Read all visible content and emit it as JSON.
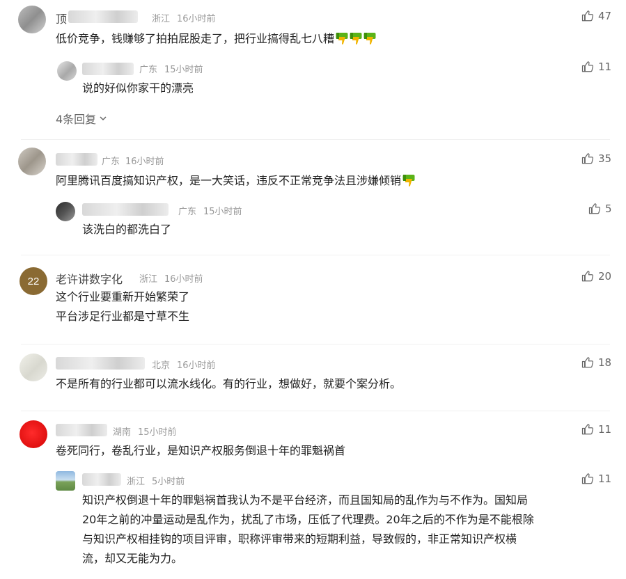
{
  "comments": [
    {
      "name": "顶",
      "location": "浙江",
      "time": "16小时前",
      "likes": "47",
      "text": "低价竞争，钱赚够了拍拍屁股走了，把行业搞得乱七八糟",
      "emoji_count": 3,
      "reply": {
        "location": "广东",
        "time": "15小时前",
        "likes": "11",
        "text": "说的好似你家干的漂亮"
      },
      "more_replies": "4条回复"
    },
    {
      "location": "广东",
      "time": "16小时前",
      "likes": "35",
      "text": "阿里腾讯百度搞知识产权，是一大笑话，违反不正常竞争法且涉嫌倾销",
      "emoji_count": 1,
      "reply": {
        "location": "广东",
        "time": "15小时前",
        "likes": "5",
        "text": "该洗白的都洗白了"
      }
    },
    {
      "name": "老许讲数字化",
      "location": "浙江",
      "time": "16小时前",
      "likes": "20",
      "line1": "这个行业要重新开始繁荣了",
      "line2": "平台涉足行业都是寸草不生",
      "avatar_text": "22"
    },
    {
      "location": "北京",
      "time": "16小时前",
      "likes": "18",
      "text": "不是所有的行业都可以流水线化。有的行业，想做好，就要个案分析。"
    },
    {
      "location": "湖南",
      "time": "15小时前",
      "likes": "11",
      "text": "卷死同行，卷乱行业，是知识产权服务倒退十年的罪魁祸首",
      "reply": {
        "location": "浙江",
        "time": "5小时前",
        "likes": "11",
        "line1": "知识产权倒退十年的罪魁祸首我认为不是平台经济，而且国知局的乱作为与不作为。国知局",
        "line2": "20年之前的冲量运动是乱作为，扰乱了市场，压低了代理费。20年之后的不作为是不能根除",
        "line3": "与知识产权相挂钩的项目评审，职称评审带来的短期利益，导致假的，非正常知识产权横",
        "line4": "流，却又无能为力。"
      }
    }
  ],
  "icon_color": "#666666",
  "emoji_colors": {
    "green": "#5bb318",
    "gold": "#f1b400"
  }
}
